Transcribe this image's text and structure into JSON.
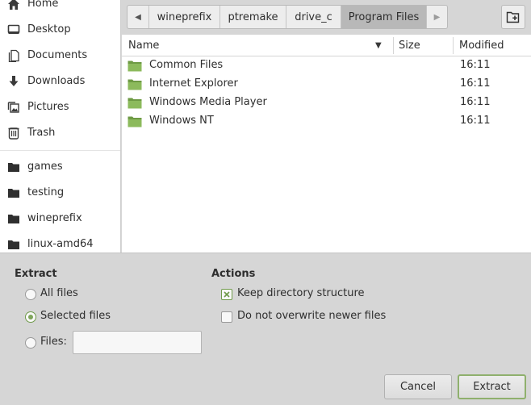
{
  "sidebar": {
    "places": [
      {
        "label": "Home",
        "icon": "home-icon"
      },
      {
        "label": "Desktop",
        "icon": "desktop-icon"
      },
      {
        "label": "Documents",
        "icon": "documents-icon"
      },
      {
        "label": "Downloads",
        "icon": "download-icon"
      },
      {
        "label": "Pictures",
        "icon": "pictures-icon"
      },
      {
        "label": "Trash",
        "icon": "trash-icon"
      }
    ],
    "bookmarks": [
      {
        "label": "games",
        "icon": "folder-icon"
      },
      {
        "label": "testing",
        "icon": "folder-icon"
      },
      {
        "label": "wineprefix",
        "icon": "folder-icon"
      },
      {
        "label": "linux-amd64",
        "icon": "folder-icon"
      }
    ]
  },
  "pathbar": {
    "crumbs": [
      "wineprefix",
      "ptremake",
      "drive_c",
      "Program Files"
    ],
    "active_crumb": "Program Files",
    "prev_icon": "chevron-left-icon",
    "next_icon": "chevron-right-icon",
    "new_folder_icon": "new-folder-icon"
  },
  "filelist": {
    "columns": {
      "name": "Name",
      "size": "Size",
      "modified": "Modified"
    },
    "sort_icon": "sort-descending-icon",
    "rows": [
      {
        "name": "Common Files",
        "size": "",
        "modified": "16:11"
      },
      {
        "name": "Internet Explorer",
        "size": "",
        "modified": "16:11"
      },
      {
        "name": "Windows Media Player",
        "size": "",
        "modified": "16:11"
      },
      {
        "name": "Windows NT",
        "size": "",
        "modified": "16:11"
      }
    ]
  },
  "extract": {
    "heading": "Extract",
    "all_files": "All files",
    "selected_files": "Selected files",
    "files_label": "Files:",
    "files_value": "",
    "selected_option": "Selected files"
  },
  "actions": {
    "heading": "Actions",
    "keep_structure": "Keep directory structure",
    "keep_structure_checked": true,
    "no_overwrite": "Do not overwrite newer files",
    "no_overwrite_checked": false
  },
  "buttons": {
    "cancel": "Cancel",
    "extract": "Extract"
  },
  "colors": {
    "accent": "#7ea45a",
    "folder": "#7aa84a",
    "selected_crumb": "#b8b8b8"
  }
}
